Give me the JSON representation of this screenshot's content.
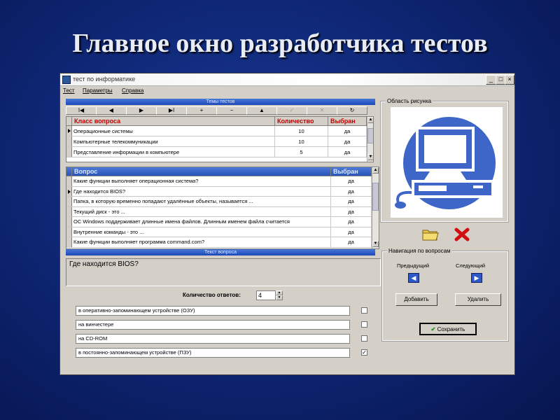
{
  "slide": {
    "title": "Главное окно разработчика тестов"
  },
  "window": {
    "title": "тест по информатике",
    "controls": {
      "minimize": "_",
      "maximize": "□",
      "close": "×"
    }
  },
  "menu": [
    "Тест",
    "Параметры",
    "Справка"
  ],
  "themes_header": "Темы тестов",
  "navigator": [
    {
      "glyph": "I◀",
      "icon": "first-record-icon",
      "disabled": false
    },
    {
      "glyph": "◀",
      "icon": "prior-record-icon",
      "disabled": false
    },
    {
      "glyph": "▶",
      "icon": "next-record-icon",
      "disabled": false
    },
    {
      "glyph": "▶I",
      "icon": "last-record-icon",
      "disabled": false
    },
    {
      "glyph": "+",
      "icon": "insert-record-icon",
      "disabled": false
    },
    {
      "glyph": "−",
      "icon": "delete-record-icon",
      "disabled": false
    },
    {
      "glyph": "▲",
      "icon": "edit-record-icon",
      "disabled": false
    },
    {
      "glyph": "✓",
      "icon": "post-record-icon",
      "disabled": true
    },
    {
      "glyph": "✕",
      "icon": "cancel-record-icon",
      "disabled": true
    },
    {
      "glyph": "↻",
      "icon": "refresh-icon",
      "disabled": false
    }
  ],
  "classes_table": {
    "headers": [
      "Класс вопроса",
      "Количество",
      "Выбран"
    ],
    "rows": [
      [
        "Операционные системы",
        "10",
        "да"
      ],
      [
        "Компьютерные телекоммуникации",
        "10",
        "да"
      ],
      [
        "Представление информации в компьютере",
        "5",
        "да"
      ]
    ],
    "current_row": 0
  },
  "questions_table": {
    "headers": [
      "Вопрос",
      "Выбран"
    ],
    "rows": [
      [
        "Какие функции выполняет операционная система?",
        "да"
      ],
      [
        "Где находится BIOS?",
        "да"
      ],
      [
        "Папка, в которую временно попадают удалённые объекты, называется ...",
        "да"
      ],
      [
        "Текущий диск - это ...",
        "да"
      ],
      [
        "ОС Windows поддерживает длинные имена файлов. Длинным именем файла считается",
        "да"
      ],
      [
        "Внутренние команды - это ...",
        "да"
      ],
      [
        "Какие функции выполняет программа command.com?",
        "да"
      ]
    ],
    "current_row": 1
  },
  "question_text_header": "Текст вопроса",
  "question_text": "Где находится BIOS?",
  "answers_count": {
    "label": "Количество ответов:",
    "value": "4"
  },
  "answers": [
    {
      "text": "в оперативно-запоминающем устройстве (ОЗУ)",
      "checked": false
    },
    {
      "text": "на винчестере",
      "checked": false
    },
    {
      "text": "на CD-ROM",
      "checked": false
    },
    {
      "text": "в постоянно-запоминающем устройстве (ПЗУ)",
      "checked": true
    }
  ],
  "picture_area": {
    "caption": "Область рисунка",
    "image": "computer-icon"
  },
  "picture_actions": {
    "open_icon": "folder-icon",
    "delete_icon": "red-x-icon"
  },
  "navigation": {
    "caption": "Навигация по вопросам",
    "prev_label": "Предыдущий",
    "next_label": "Следующий",
    "add_button": "Добавить",
    "delete_button": "Удалить",
    "save_button": "Сохранить"
  }
}
